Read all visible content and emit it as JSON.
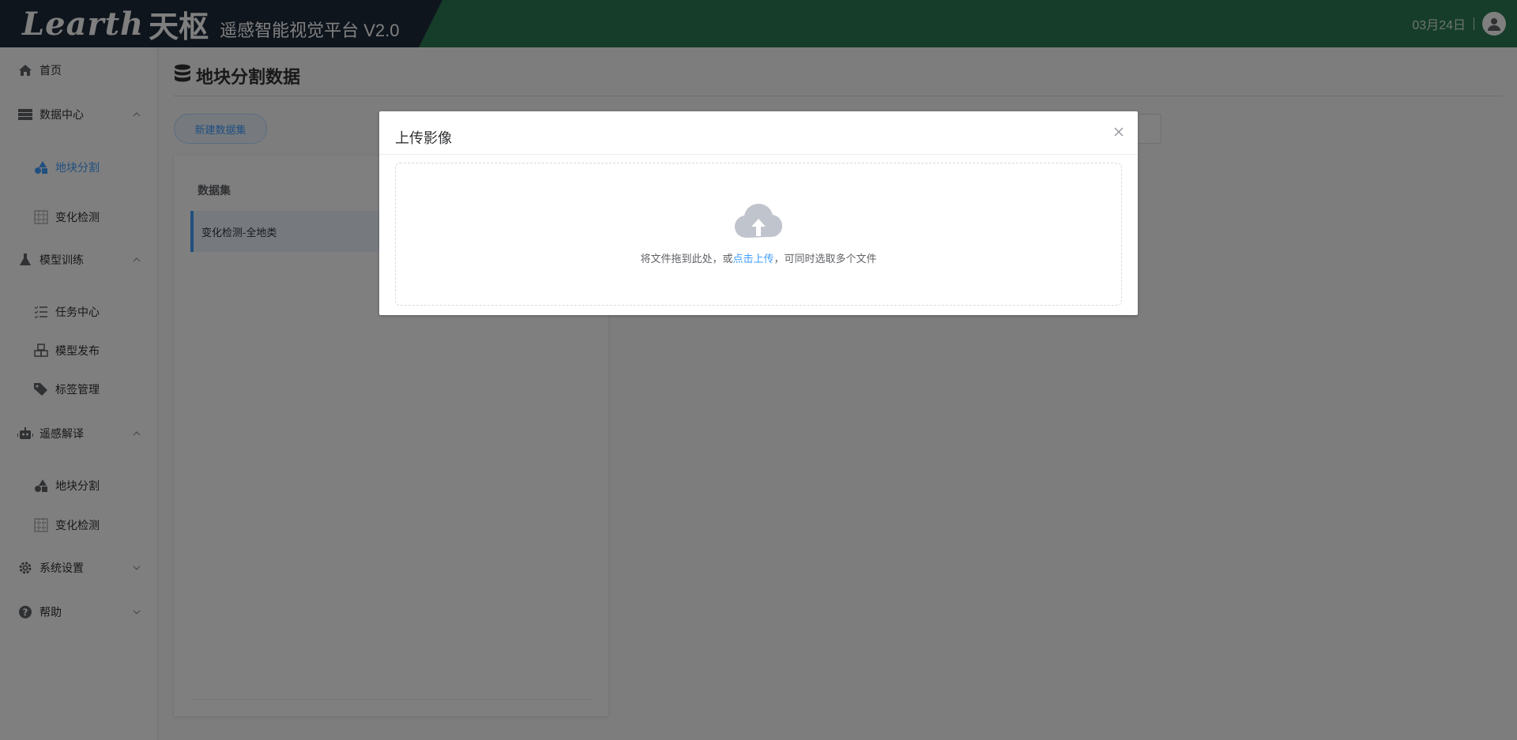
{
  "header": {
    "logo": "Learth",
    "brand_cn": "天枢",
    "subtitle": "遥感智能视觉平台 V2.0",
    "date": "03月24日"
  },
  "sidebar": {
    "items": [
      {
        "label": "首页",
        "icon": "home-icon"
      },
      {
        "label": "数据中心",
        "icon": "database-icon",
        "expanded": true
      },
      {
        "label": "地块分割",
        "icon": "shapes-icon",
        "active": true
      },
      {
        "label": "变化检测",
        "icon": "grid-icon"
      },
      {
        "label": "模型训练",
        "icon": "flask-icon",
        "expanded": true
      },
      {
        "label": "任务中心",
        "icon": "task-list-icon"
      },
      {
        "label": "模型发布",
        "icon": "cubes-icon"
      },
      {
        "label": "标签管理",
        "icon": "tags-icon"
      },
      {
        "label": "遥感解译",
        "icon": "robot-icon",
        "expanded": true
      },
      {
        "label": "地块分割",
        "icon": "shapes-icon"
      },
      {
        "label": "变化检测",
        "icon": "grid-icon"
      },
      {
        "label": "系统设置",
        "icon": "gear-icon",
        "expanded": false
      },
      {
        "label": "帮助",
        "icon": "help-icon",
        "expanded": false
      }
    ]
  },
  "main": {
    "page_title": "地块分割数据",
    "new_dataset_button": "新建数据集",
    "panel_header": "数据集",
    "dataset_rows": [
      "变化检测-全地类"
    ]
  },
  "dialog": {
    "title": "上传影像",
    "drop_text_before": "将文件拖到此处，或",
    "drop_link": "点击上传",
    "drop_text_after": "，可同时选取多个文件"
  },
  "colors": {
    "header_green": "#2d7a52",
    "brand_navy": "#1e2a3a",
    "accent_blue": "#409eff"
  }
}
